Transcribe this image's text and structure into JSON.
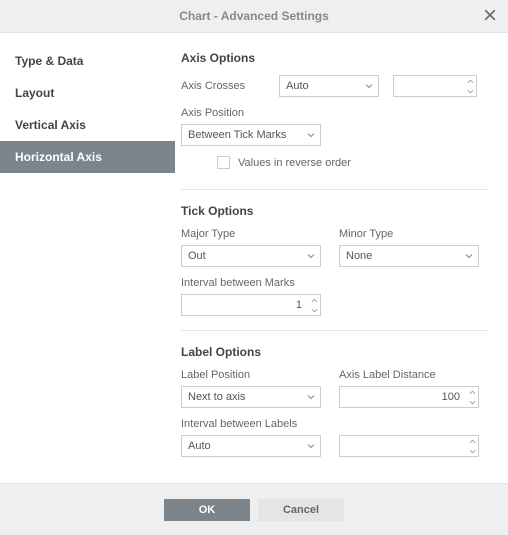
{
  "dialog": {
    "title": "Chart - Advanced Settings",
    "close_icon": "close",
    "footer": {
      "ok": "OK",
      "cancel": "Cancel"
    }
  },
  "sidebar": {
    "items": [
      {
        "label": "Type & Data"
      },
      {
        "label": "Layout"
      },
      {
        "label": "Vertical Axis"
      },
      {
        "label": "Horizontal Axis"
      }
    ],
    "active_index": 3
  },
  "axis_options": {
    "heading": "Axis Options",
    "axis_crosses_label": "Axis Crosses",
    "axis_crosses_value": "Auto",
    "axis_crosses_numeric": "",
    "axis_position_label": "Axis Position",
    "axis_position_value": "Between Tick Marks",
    "reverse_label": "Values in reverse order",
    "reverse_checked": false
  },
  "tick_options": {
    "heading": "Tick Options",
    "major_type_label": "Major Type",
    "major_type_value": "Out",
    "minor_type_label": "Minor Type",
    "minor_type_value": "None",
    "interval_marks_label": "Interval between Marks",
    "interval_marks_value": "1"
  },
  "label_options": {
    "heading": "Label Options",
    "label_position_label": "Label Position",
    "label_position_value": "Next to axis",
    "axis_label_distance_label": "Axis Label Distance",
    "axis_label_distance_value": "100",
    "interval_labels_label": "Interval between Labels",
    "interval_labels_select": "Auto",
    "interval_labels_numeric": ""
  }
}
